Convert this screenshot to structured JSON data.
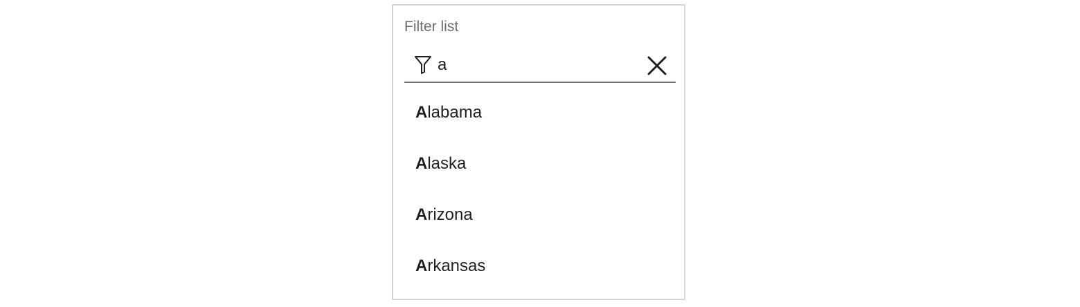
{
  "panel": {
    "title": "Filter list"
  },
  "search": {
    "value": "a",
    "filter_icon": "filter-icon",
    "clear_icon": "close-icon"
  },
  "results": [
    {
      "match": "A",
      "rest": "labama"
    },
    {
      "match": "A",
      "rest": "laska"
    },
    {
      "match": "A",
      "rest": "rizona"
    },
    {
      "match": "A",
      "rest": "rkansas"
    }
  ],
  "colors": {
    "border": "#d4d4d6",
    "underline": "#6f6f74",
    "title_text": "#6b6b70",
    "text": "#1f1f22"
  }
}
